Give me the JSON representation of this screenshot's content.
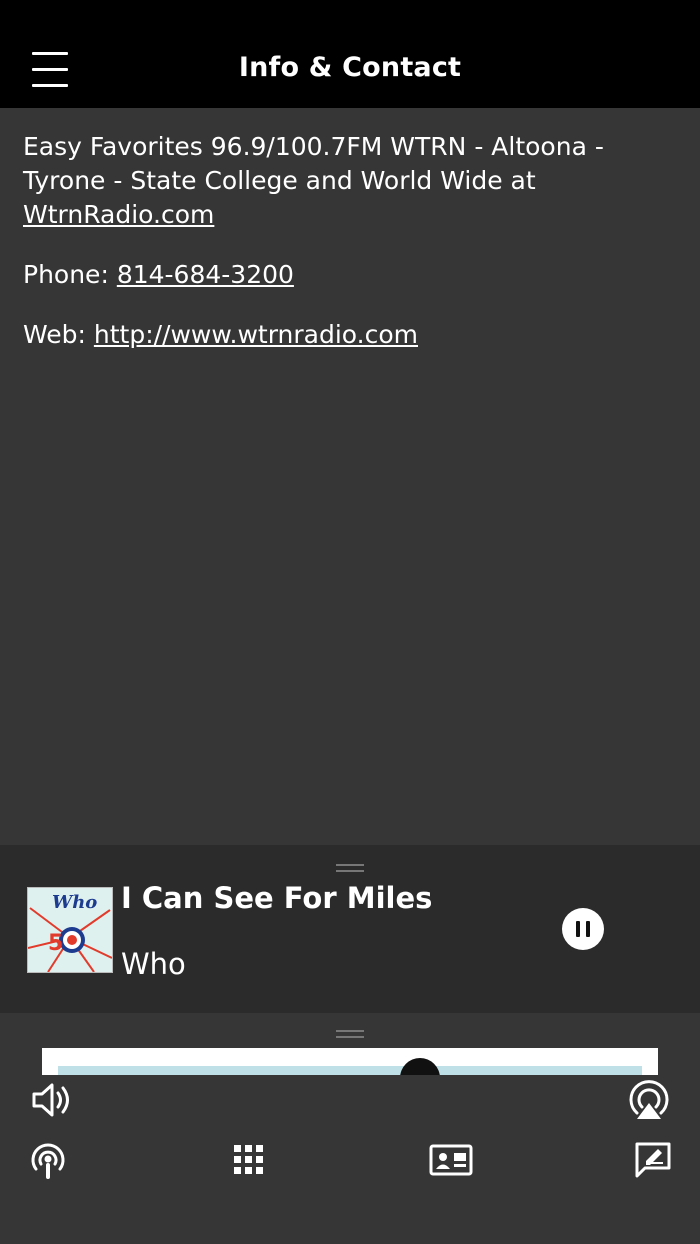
{
  "header": {
    "title": "Info & Contact",
    "menu_icon": "hamburger-menu-icon"
  },
  "info": {
    "description_text": "Easy Favorites 96.9/100.7FM WTRN - Altoona - Tyrone - State College and World Wide at ",
    "description_link": "WtrnRadio.com",
    "phone_label": "Phone: ",
    "phone_value": "814-684-3200",
    "web_label": "Web: ",
    "web_value": "http://www.wtrnradio.com"
  },
  "player": {
    "song_title": "I Can See For Miles",
    "artist": "Who",
    "album_art_label": "Who",
    "state": "playing",
    "pause_icon": "pause-icon"
  },
  "bottom_bar": {
    "icons": [
      "volume-icon",
      "airplay-icon",
      "podcast-icon",
      "grid-icon",
      "contact-card-icon",
      "feedback-icon"
    ]
  },
  "colors": {
    "header_bg": "#000000",
    "content_bg": "#363636",
    "player_bg": "#2b2b2b",
    "text": "#ffffff"
  }
}
